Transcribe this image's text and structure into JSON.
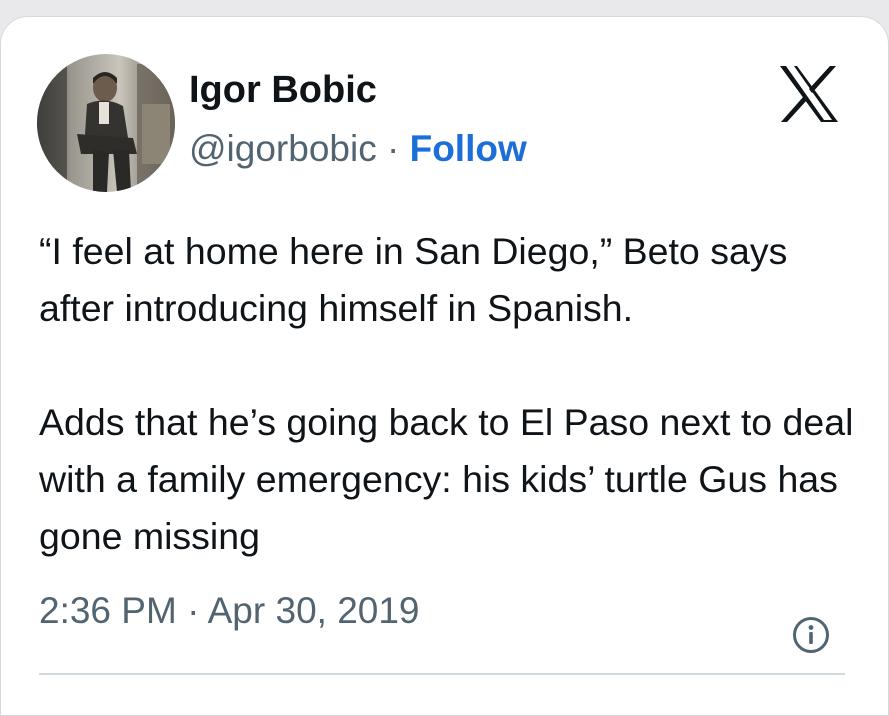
{
  "author": {
    "name": "Igor Bobic",
    "handle": "@igorbobic",
    "separator": "·",
    "follow_label": "Follow"
  },
  "tweet": {
    "paragraphs": [
      "“I feel at home here in San Diego,” Beto says after introducing himself in Spanish.",
      "Adds that he’s going back to El Paso next to deal with a family emergency: his kids’ turtle Gus has gone missing"
    ],
    "timestamp": "2:36 PM · Apr 30, 2019"
  },
  "icons": {
    "platform": "x-logo-icon",
    "info": "info-icon",
    "avatar": "profile-photo"
  },
  "colors": {
    "text": "#0f1419",
    "secondary": "#536471",
    "follow": "#1d6fd8",
    "divider": "#cfd9de"
  }
}
